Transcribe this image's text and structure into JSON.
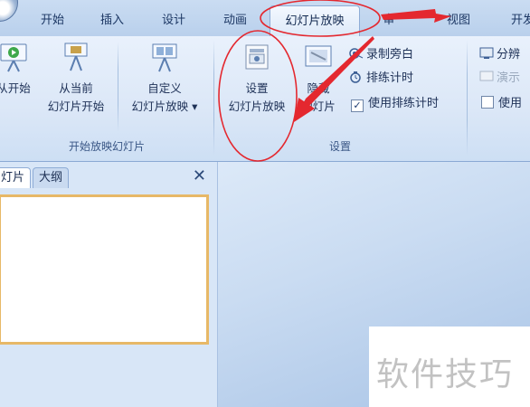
{
  "tabs": [
    {
      "label": "开始"
    },
    {
      "label": "插入"
    },
    {
      "label": "设计"
    },
    {
      "label": "动画"
    },
    {
      "label": "幻灯片放映"
    },
    {
      "label": "审"
    },
    {
      "label": "视图"
    },
    {
      "label": "开发"
    }
  ],
  "ribbon": {
    "start_group": {
      "label": "开始放映幻灯片",
      "from_beginning": "从开始",
      "from_current_line1": "从当前",
      "from_current_line2": "幻灯片开始",
      "custom_line1": "自定义",
      "custom_line2": "幻灯片放映 ▾"
    },
    "setup_group": {
      "label": "设置",
      "setup_line1": "设置",
      "setup_line2": "幻灯片放映",
      "hide_line1": "隐藏",
      "hide_line2": "幻灯片",
      "record": "录制旁白",
      "rehearse": "排练计时",
      "use_timings": "使用排练计时",
      "use_timings_checked": true
    },
    "monitors_group": {
      "resolution": "分辨",
      "presenter": "演示",
      "use": "使用"
    }
  },
  "panel": {
    "tab_slides": "灯片",
    "tab_outline": "大纲",
    "close": "✕"
  },
  "watermark": "软件技巧",
  "colors": {
    "annotation": "#e4282f",
    "thumbnail_border": "#e7b867",
    "ribbon_bg": "#dbe7f7"
  }
}
